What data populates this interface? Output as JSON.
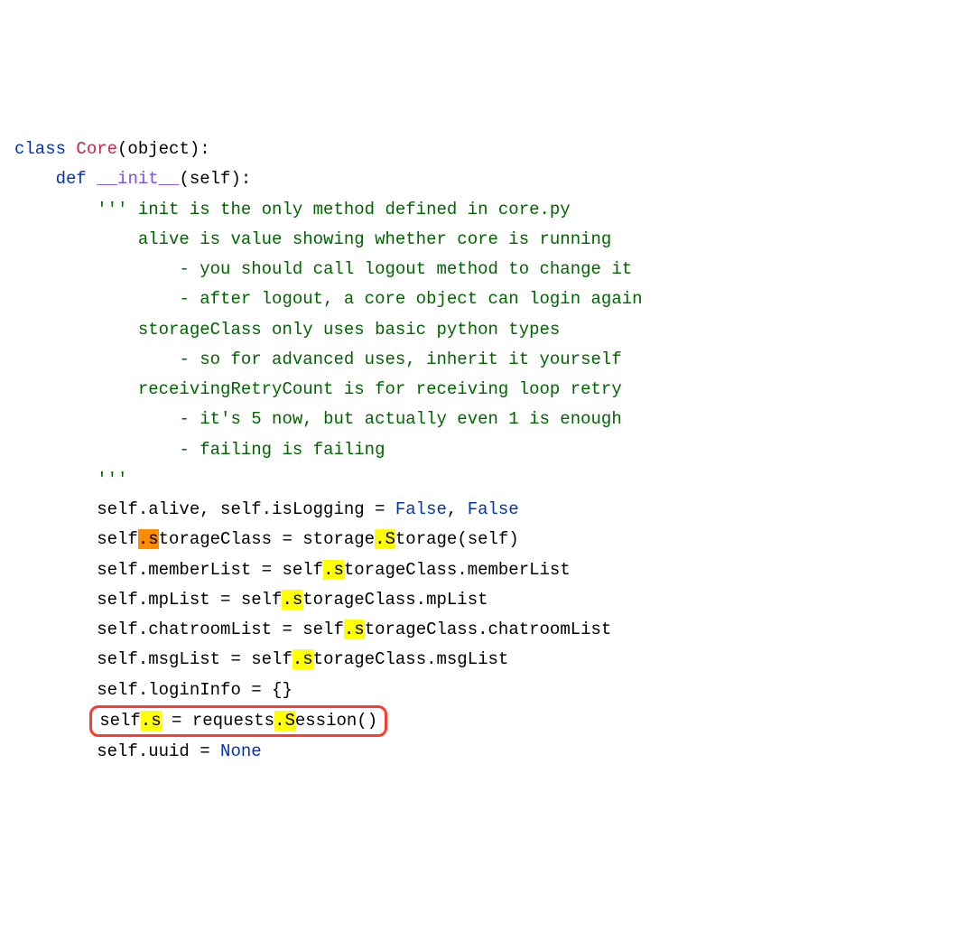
{
  "code": {
    "line1": {
      "kw": "class",
      "space1": " ",
      "cls": "Core",
      "rest": "(object):"
    },
    "line2": {
      "indent": "    ",
      "kw": "def",
      "space1": " ",
      "fn": "__init__",
      "rest": "(self):"
    },
    "line3": {
      "indent": "        ",
      "str": "''' init is the only method defined in core.py"
    },
    "line4": {
      "indent": "            ",
      "str": "alive is value showing whether core is running"
    },
    "line5": {
      "indent": "                ",
      "str": "- you should call logout method to change it"
    },
    "line6": {
      "indent": "                ",
      "str": "- after logout, a core object can login again"
    },
    "line7": {
      "indent": "            ",
      "str": "storageClass only uses basic python types"
    },
    "line8": {
      "indent": "                ",
      "str": "- so for advanced uses, inherit it yourself"
    },
    "line9": {
      "indent": "            ",
      "str": "receivingRetryCount is for receiving loop retry"
    },
    "line10": {
      "indent": "                ",
      "str": "- it's 5 now, but actually even 1 is enough"
    },
    "line11": {
      "indent": "                ",
      "str": "- failing is failing"
    },
    "line12": {
      "indent": "        ",
      "str": "'''"
    },
    "line13": {
      "indent": "        ",
      "p1": "self.alive, self.isLogging = ",
      "c1": "False",
      "p2": ", ",
      "c2": "False"
    },
    "line14": {
      "indent": "        ",
      "p1": "self",
      "hl1": ".s",
      "p2": "torageClass = storage",
      "hl2": ".S",
      "p3": "torage(self)"
    },
    "line15": {
      "indent": "        ",
      "p1": "self.memberList = self",
      "hl1": ".s",
      "p2": "torageClass.memberList"
    },
    "line16": {
      "indent": "        ",
      "p1": "self.mpList = self",
      "hl1": ".s",
      "p2": "torageClass.mpList"
    },
    "line17": {
      "indent": "        ",
      "p1": "self.chatroomList = self",
      "hl1": ".s",
      "p2": "torageClass.chatroomList"
    },
    "line18": {
      "indent": "        ",
      "p1": "self.msgList = self",
      "hl1": ".s",
      "p2": "torageClass.msgList"
    },
    "line19": {
      "indent": "        ",
      "p1": "self.loginInfo = {}"
    },
    "line20": {
      "indent": "        ",
      "p1": "self",
      "hl1": ".s",
      "p2": " = requests",
      "hl2": ".S",
      "p3": "ession()"
    },
    "line21": {
      "indent": "        ",
      "p1": "self.uuid = ",
      "c1": "None"
    }
  }
}
